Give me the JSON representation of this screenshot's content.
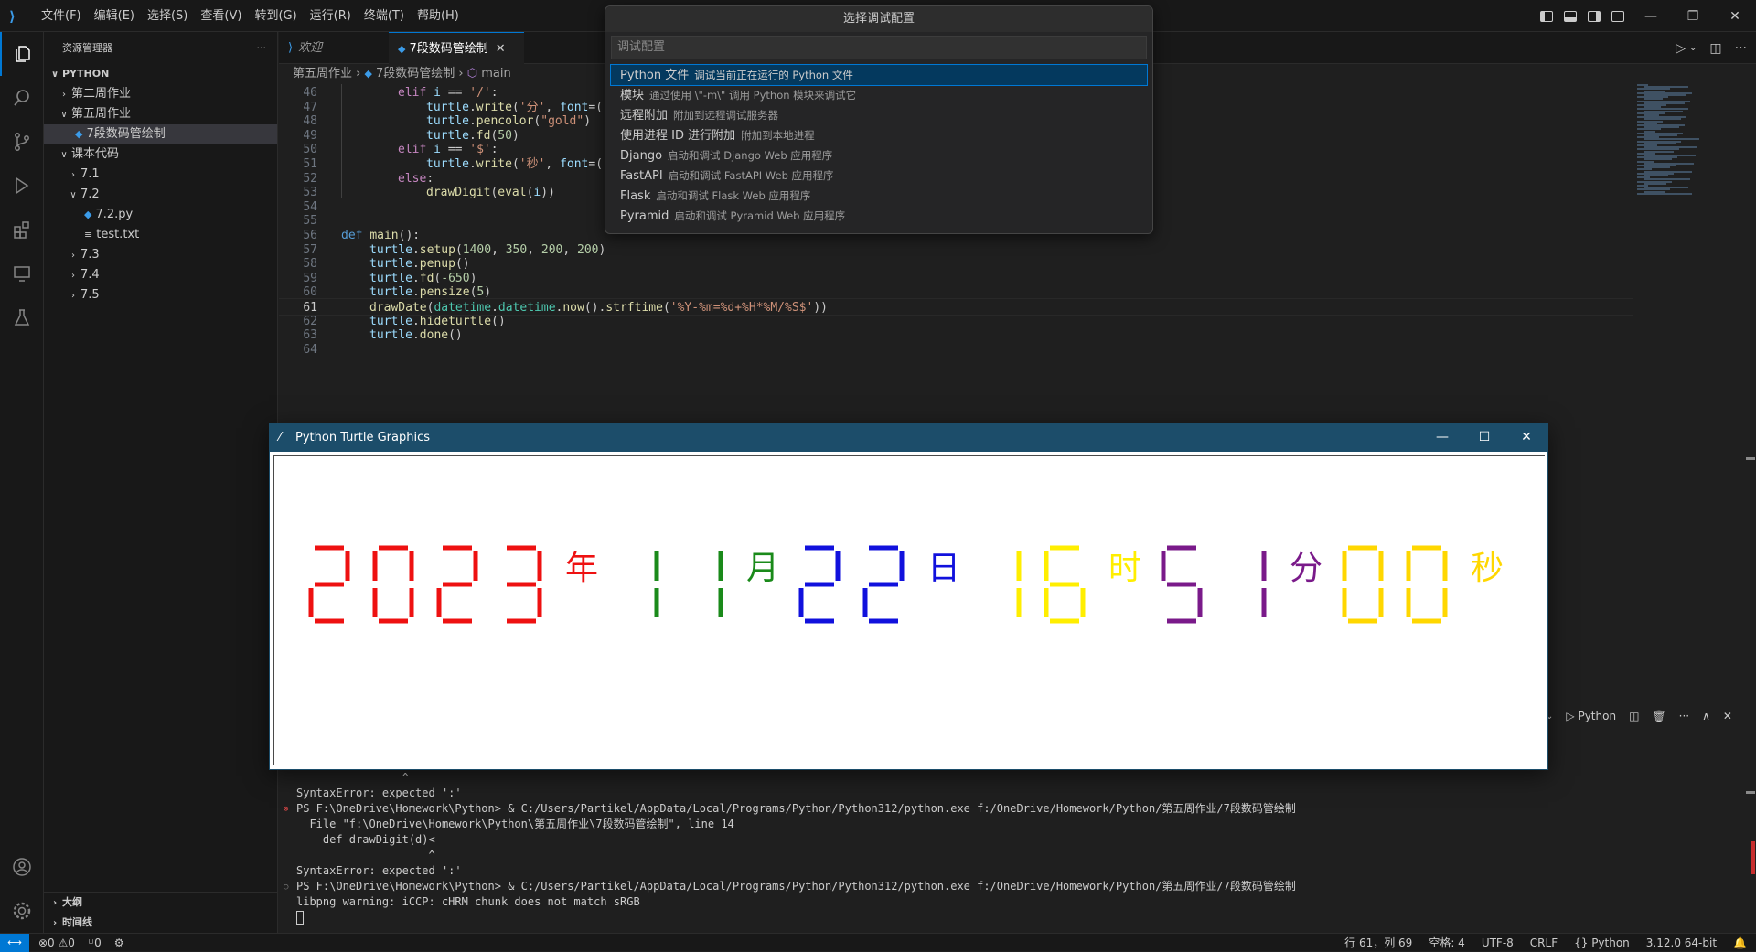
{
  "menu": [
    "文件(F)",
    "编辑(E)",
    "选择(S)",
    "查看(V)",
    "转到(G)",
    "运行(R)",
    "终端(T)",
    "帮助(H)"
  ],
  "sidebar": {
    "title": "资源管理器",
    "more": "···",
    "tree": [
      {
        "label": "PYTHON",
        "chev": "∨",
        "depth": 0,
        "kind": "root"
      },
      {
        "label": "第二周作业",
        "chev": "›",
        "depth": 1,
        "kind": "folder"
      },
      {
        "label": "第五周作业",
        "chev": "∨",
        "depth": 1,
        "kind": "folder"
      },
      {
        "label": "7段数码管绘制",
        "chev": "",
        "depth": 2,
        "kind": "py",
        "selected": true
      },
      {
        "label": "课本代码",
        "chev": "∨",
        "depth": 1,
        "kind": "folder"
      },
      {
        "label": "7.1",
        "chev": "›",
        "depth": 2,
        "kind": "folder"
      },
      {
        "label": "7.2",
        "chev": "∨",
        "depth": 2,
        "kind": "folder"
      },
      {
        "label": "7.2.py",
        "chev": "",
        "depth": 3,
        "kind": "py"
      },
      {
        "label": "test.txt",
        "chev": "",
        "depth": 3,
        "kind": "txt"
      },
      {
        "label": "7.3",
        "chev": "›",
        "depth": 2,
        "kind": "folder"
      },
      {
        "label": "7.4",
        "chev": "›",
        "depth": 2,
        "kind": "folder"
      },
      {
        "label": "7.5",
        "chev": "›",
        "depth": 2,
        "kind": "folder"
      }
    ],
    "outline": "大纲",
    "timeline": "时间线"
  },
  "tabs": [
    {
      "label": "欢迎",
      "active": false
    },
    {
      "label": "7段数码管绘制",
      "active": true
    }
  ],
  "breadcrumb": {
    "folder": "第五周作业",
    "file": "7段数码管绘制",
    "symbol": "main"
  },
  "editor": {
    "current_line": 61,
    "lines": [
      {
        "n": 46,
        "indent": 2,
        "html": "<span class='kw'>elif</span> <span class='var'>i</span> == <span class='str'>'/'</span>:"
      },
      {
        "n": 47,
        "indent": 3,
        "html": "<span class='var'>turtle</span>.<span class='fn'>write</span>(<span class='str'>'分'</span>, <span class='var'>font</span>=(<span class='str'>\"</span>"
      },
      {
        "n": 48,
        "indent": 3,
        "html": "<span class='var'>turtle</span>.<span class='fn'>pencolor</span>(<span class='str'>\"gold\"</span>)"
      },
      {
        "n": 49,
        "indent": 3,
        "html": "<span class='var'>turtle</span>.<span class='fn'>fd</span>(<span class='num'>50</span>)"
      },
      {
        "n": 50,
        "indent": 2,
        "html": "<span class='kw'>elif</span> <span class='var'>i</span> == <span class='str'>'$'</span>:"
      },
      {
        "n": 51,
        "indent": 3,
        "html": "<span class='var'>turtle</span>.<span class='fn'>write</span>(<span class='str'>'秒'</span>, <span class='var'>font</span>=(<span class='str'>\"</span>"
      },
      {
        "n": 52,
        "indent": 2,
        "html": "<span class='kw'>else</span>:"
      },
      {
        "n": 53,
        "indent": 3,
        "html": "<span class='fn'>drawDigit</span>(<span class='fn'>eval</span>(<span class='var'>i</span>))"
      },
      {
        "n": 54,
        "indent": 0,
        "html": ""
      },
      {
        "n": 55,
        "indent": 0,
        "html": ""
      },
      {
        "n": 56,
        "indent": 0,
        "html": "<span class='def'>def</span> <span class='fn'>main</span>():"
      },
      {
        "n": 57,
        "indent": 1,
        "html": "<span class='var'>turtle</span>.<span class='fn'>setup</span>(<span class='num'>1400</span>, <span class='num'>350</span>, <span class='num'>200</span>, <span class='num'>200</span>)"
      },
      {
        "n": 58,
        "indent": 1,
        "html": "<span class='var'>turtle</span>.<span class='fn'>penup</span>()"
      },
      {
        "n": 59,
        "indent": 1,
        "html": "<span class='var'>turtle</span>.<span class='fn'>fd</span>(<span class='num'>-650</span>)"
      },
      {
        "n": 60,
        "indent": 1,
        "html": "<span class='var'>turtle</span>.<span class='fn'>pensize</span>(<span class='num'>5</span>)"
      },
      {
        "n": 61,
        "indent": 1,
        "html": "<span class='fn'>drawDate</span>(<span class='cls'>datetime</span>.<span class='cls'>datetime</span>.<span class='fn'>now</span>().<span class='fn'>strftime</span>(<span class='str'>'%Y-%m=%d+%H*%M/%S$'</span>))"
      },
      {
        "n": 62,
        "indent": 1,
        "html": "<span class='var'>turtle</span>.<span class='fn'>hideturtle</span>()"
      },
      {
        "n": 63,
        "indent": 1,
        "html": "<span class='var'>turtle</span>.<span class='fn'>done</span>()"
      },
      {
        "n": 64,
        "indent": 0,
        "html": ""
      }
    ]
  },
  "quickpick": {
    "title": "选择调试配置",
    "placeholder": "调试配置",
    "items": [
      {
        "label": "Python 文件",
        "desc": "调试当前正在运行的 Python 文件",
        "selected": true
      },
      {
        "label": "模块",
        "desc": "通过使用 \\\"-m\\\" 调用 Python 模块来调试它",
        "selected": false
      },
      {
        "label": "远程附加",
        "desc": "附加到远程调试服务器",
        "selected": false
      },
      {
        "label": "使用进程 ID 进行附加",
        "desc": "附加到本地进程",
        "selected": false
      },
      {
        "label": "Django",
        "desc": "启动和调试 Django Web 应用程序",
        "selected": false
      },
      {
        "label": "FastAPI",
        "desc": "启动和调试 FastAPI Web 应用程序",
        "selected": false
      },
      {
        "label": "Flask",
        "desc": "启动和调试 Flask Web 应用程序",
        "selected": false
      },
      {
        "label": "Pyramid",
        "desc": "启动和调试 Pyramid Web 应用程序",
        "selected": false
      }
    ]
  },
  "turtle_window": {
    "title": "Python Turtle Graphics",
    "display": [
      {
        "type": "digits",
        "text": "2023",
        "color": "#ee1111"
      },
      {
        "type": "char",
        "text": "年",
        "color": "#ee1111"
      },
      {
        "type": "digits",
        "text": "11",
        "color": "#1a8a1a"
      },
      {
        "type": "char",
        "text": "月",
        "color": "#1a8a1a"
      },
      {
        "type": "digits",
        "text": "22",
        "color": "#1111dd"
      },
      {
        "type": "char",
        "text": "日",
        "color": "#1111dd"
      },
      {
        "type": "digits",
        "text": "16",
        "color": "#ffee00"
      },
      {
        "type": "char",
        "text": "时",
        "color": "#ffee00"
      },
      {
        "type": "digits",
        "text": "51",
        "color": "#7a1a8a"
      },
      {
        "type": "char",
        "text": "分",
        "color": "#7a1a8a"
      },
      {
        "type": "digits",
        "text": "00",
        "color": "#ffd700"
      },
      {
        "type": "char",
        "text": "秒",
        "color": "#ffd700"
      }
    ]
  },
  "panel": {
    "terminal_name": "Python"
  },
  "terminal": [
    {
      "mark": "",
      "text": "                ^"
    },
    {
      "mark": "",
      "text": "SyntaxError: expected ':'"
    },
    {
      "mark": "err",
      "text": "PS F:\\OneDrive\\Homework\\Python> & C:/Users/Partikel/AppData/Local/Programs/Python/Python312/python.exe f:/OneDrive/Homework/Python/第五周作业/7段数码管绘制"
    },
    {
      "mark": "",
      "text": "  File \"f:\\OneDrive\\Homework\\Python\\第五周作业\\7段数码管绘制\", line 14"
    },
    {
      "mark": "",
      "text": "    def drawDigit(d)<"
    },
    {
      "mark": "",
      "text": "                    ^"
    },
    {
      "mark": "",
      "text": "SyntaxError: expected ':'"
    },
    {
      "mark": "ok",
      "text": "PS F:\\OneDrive\\Homework\\Python> & C:/Users/Partikel/AppData/Local/Programs/Python/Python312/python.exe f:/OneDrive/Homework/Python/第五周作业/7段数码管绘制"
    },
    {
      "mark": "",
      "text": "libpng warning: iCCP: cHRM chunk does not match sRGB"
    }
  ],
  "status": {
    "errors": "⊗0 ⚠0",
    "ports": "⑂0",
    "position": "行 61，列 69",
    "spaces": "空格: 4",
    "encoding": "UTF-8",
    "eol": "CRLF",
    "language": "{} Python",
    "interpreter": "3.12.0 64-bit"
  }
}
